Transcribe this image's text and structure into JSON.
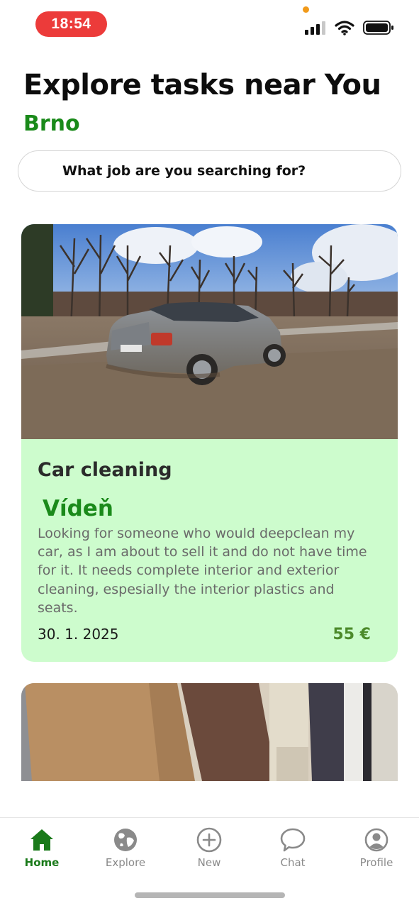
{
  "status_bar": {
    "time": "18:54"
  },
  "header": {
    "title": "Explore tasks near You",
    "location": "Brno"
  },
  "search": {
    "placeholder": "What job are you searching for?"
  },
  "tasks": [
    {
      "title": "Car cleaning",
      "city": "Vídeň",
      "description": "Looking for someone who would deepclean my car, as I am about to sell it and do not have time for it. It needs complete interior and exterior cleaning, espesially the interior plastics and seats.",
      "date": "30. 1. 2025",
      "price": "55 €"
    }
  ],
  "tab_bar": {
    "items": [
      {
        "label": "Home",
        "icon": "home-icon",
        "active": true
      },
      {
        "label": "Explore",
        "icon": "globe-icon",
        "active": false
      },
      {
        "label": "New",
        "icon": "plus-circle-icon",
        "active": false
      },
      {
        "label": "Chat",
        "icon": "chat-bubble-icon",
        "active": false
      },
      {
        "label": "Profile",
        "icon": "profile-icon",
        "active": false
      }
    ]
  },
  "colors": {
    "accent_green": "#1a8a1a",
    "card_background": "#cdfccd",
    "price_green": "#4c8a2a",
    "time_pill": "#ec3b3a"
  }
}
